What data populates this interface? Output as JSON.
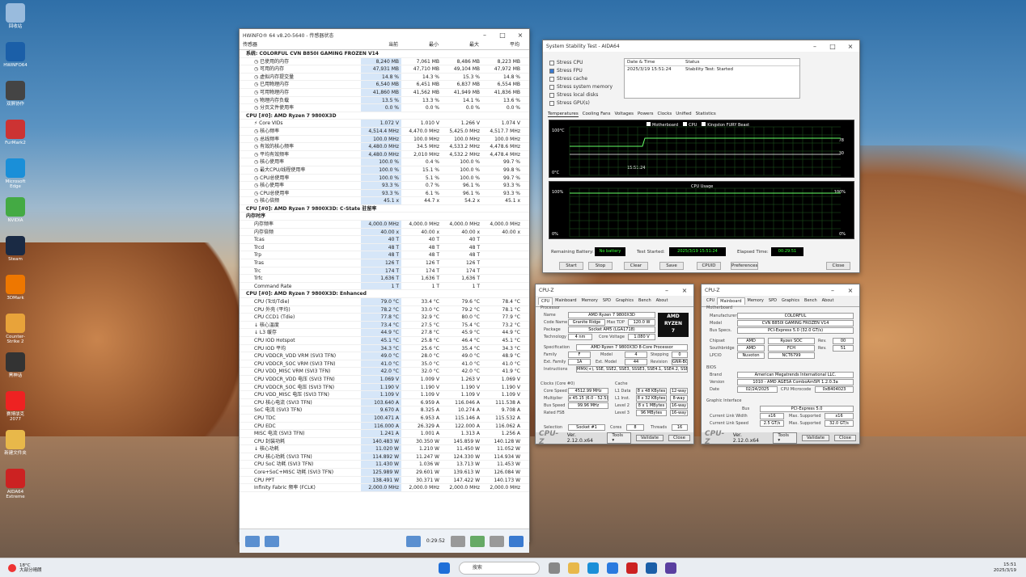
{
  "desktop": {
    "icons": [
      {
        "label": "回收站",
        "color": "#9bd"
      },
      {
        "label": "HWiNFO64",
        "color": "#1b5fa8"
      },
      {
        "label": "双屏协作",
        "color": "#444"
      },
      {
        "label": "FurMark2",
        "color": "#c33"
      },
      {
        "label": "Microsoft Edge",
        "color": "#1a8fd8"
      },
      {
        "label": "NVIDIA",
        "color": "#4a4"
      },
      {
        "label": "Steam",
        "color": "#1a2a44"
      },
      {
        "label": "3DMark",
        "color": "#e70"
      },
      {
        "label": "Counter-Strike 2",
        "color": "#e8a33a"
      },
      {
        "label": "黑神话",
        "color": "#333"
      },
      {
        "label": "赛博朋克 2077",
        "color": "#e22"
      },
      {
        "label": "新建文件夹",
        "color": "#e8b84a"
      },
      {
        "label": "AIDA64 Extreme",
        "color": "#c22"
      }
    ]
  },
  "hwinfo": {
    "title": "HWiNFO® 64 v8.20-5640 - 传感器状态",
    "cols": [
      "传感器",
      "当前",
      "最小",
      "最大",
      "平均"
    ],
    "rows": [
      {
        "g": 1,
        "n": "系统: COLORFUL CVN B850I GAMING FROZEN V14"
      },
      {
        "n": "◷ 已使用的内存",
        "v": [
          "8,240 MB",
          "7,061 MB",
          "8,486 MB",
          "8,223 MB"
        ]
      },
      {
        "n": "◷ 可用的内存",
        "v": [
          "47,931 MB",
          "47,710 MB",
          "49,104 MB",
          "47,972 MB"
        ]
      },
      {
        "n": "◷ 虚拟内存提交量",
        "v": [
          "14.8 %",
          "14.3 %",
          "15.3 %",
          "14.8 %"
        ]
      },
      {
        "n": "◷ 已用物理内存",
        "v": [
          "6,540 MB",
          "6,451 MB",
          "6,837 MB",
          "6,554 MB"
        ]
      },
      {
        "n": "◷ 可用物理内存",
        "v": [
          "41,860 MB",
          "41,562 MB",
          "41,949 MB",
          "41,836 MB"
        ]
      },
      {
        "n": "◷ 物理内存负载",
        "v": [
          "13.5 %",
          "13.3 %",
          "14.1 %",
          "13.6 %"
        ]
      },
      {
        "n": "◷ 分页文件使用率",
        "v": [
          "0.0 %",
          "0.0 %",
          "0.0 %",
          "0.0 %"
        ]
      },
      {
        "g": 1,
        "n": "CPU [#0]: AMD Ryzen 7 9800X3D"
      },
      {
        "n": "⚡ Core VIDs",
        "v": [
          "1.072 V",
          "1.010 V",
          "1.266 V",
          "1.074 V"
        ]
      },
      {
        "n": "◷ 核心频率",
        "v": [
          "4,514.4 MHz",
          "4,470.0 MHz",
          "5,425.0 MHz",
          "4,517.7 MHz"
        ]
      },
      {
        "n": "◷ 总线频率",
        "v": [
          "100.0 MHz",
          "100.0 MHz",
          "100.0 MHz",
          "100.0 MHz"
        ]
      },
      {
        "n": "◷ 有效的核心频率",
        "v": [
          "4,480.0 MHz",
          "34.5 MHz",
          "4,533.2 MHz",
          "4,478.6 MHz"
        ]
      },
      {
        "n": "◷ 平均有效频率",
        "v": [
          "4,480.0 MHz",
          "2,010 MHz",
          "4,532.2 MHz",
          "4,478.4 MHz"
        ]
      },
      {
        "n": "◷ 核心使用率",
        "v": [
          "100.0 %",
          "0.4 %",
          "100.0 %",
          "99.7 %"
        ]
      },
      {
        "n": "◷ 最大CPU/线程使用率",
        "v": [
          "100.0 %",
          "15.1 %",
          "100.0 %",
          "99.8 %"
        ]
      },
      {
        "n": "◷ CPU总使用率",
        "v": [
          "100.0 %",
          "5.1 %",
          "100.0 %",
          "99.7 %"
        ]
      },
      {
        "n": "◷ 核心使用率",
        "v": [
          "93.3 %",
          "0.7 %",
          "96.1 %",
          "93.3 %"
        ]
      },
      {
        "n": "◷ CPU总使用率",
        "v": [
          "93.3 %",
          "6.1 %",
          "96.1 %",
          "93.3 %"
        ]
      },
      {
        "n": "◷ 核心倍频",
        "v": [
          "45.1 x",
          "44.7 x",
          "54.2 x",
          "45.1 x"
        ]
      },
      {
        "g": 1,
        "n": "CPU [#0]: AMD Ryzen 7 9800X3D: C-State 驻留率"
      },
      {
        "g": 1,
        "n": "内存时序"
      },
      {
        "n": "内存频率",
        "v": [
          "4,000.0 MHz",
          "4,000.0 MHz",
          "4,000.0 MHz",
          "4,000.0 MHz"
        ]
      },
      {
        "n": "内存倍频",
        "v": [
          "40.00 x",
          "40.00 x",
          "40.00 x",
          "40.00 x"
        ]
      },
      {
        "n": "Tcas",
        "v": [
          "40 T",
          "40 T",
          "40 T",
          ""
        ]
      },
      {
        "n": "Trcd",
        "v": [
          "48 T",
          "48 T",
          "48 T",
          ""
        ]
      },
      {
        "n": "Trp",
        "v": [
          "48 T",
          "48 T",
          "48 T",
          ""
        ]
      },
      {
        "n": "Tras",
        "v": [
          "126 T",
          "126 T",
          "126 T",
          ""
        ]
      },
      {
        "n": "Trc",
        "v": [
          "174 T",
          "174 T",
          "174 T",
          ""
        ]
      },
      {
        "n": "Trfc",
        "v": [
          "1,636 T",
          "1,636 T",
          "1,636 T",
          ""
        ]
      },
      {
        "n": "Command Rate",
        "v": [
          "1 T",
          "1 T",
          "1 T",
          ""
        ]
      },
      {
        "g": 1,
        "n": "CPU [#0]: AMD Ryzen 7 9800X3D: Enhanced"
      },
      {
        "n": "CPU (Tctl/Tdie)",
        "v": [
          "79.0 °C",
          "33.4 °C",
          "79.6 °C",
          "78.4 °C"
        ]
      },
      {
        "n": "CPU 外壳 (平均)",
        "v": [
          "78.2 °C",
          "33.0 °C",
          "79.2 °C",
          "78.1 °C"
        ]
      },
      {
        "n": "CPU CCD1 (Tdie)",
        "v": [
          "77.8 °C",
          "32.9 °C",
          "80.0 °C",
          "77.9 °C"
        ]
      },
      {
        "n": "↓ 核心温度",
        "v": [
          "73.4 °C",
          "27.5 °C",
          "75.4 °C",
          "73.2 °C"
        ]
      },
      {
        "n": "↓ L3 缓存",
        "v": [
          "44.9 °C",
          "27.8 °C",
          "45.9 °C",
          "44.9 °C"
        ]
      },
      {
        "n": "CPU IOD Hotspot",
        "v": [
          "45.1 °C",
          "25.8 °C",
          "46.4 °C",
          "45.1 °C"
        ]
      },
      {
        "n": "CPU IOD 平均",
        "v": [
          "34.3 °C",
          "25.6 °C",
          "35.4 °C",
          "34.3 °C"
        ]
      },
      {
        "n": "CPU VDDCR_VDD VRM (SVI3 TFN)",
        "v": [
          "49.0 °C",
          "28.0 °C",
          "49.0 °C",
          "48.9 °C"
        ]
      },
      {
        "n": "CPU VDDCR_SOC VRM (SVI3 TFN)",
        "v": [
          "41.0 °C",
          "35.0 °C",
          "41.0 °C",
          "41.0 °C"
        ]
      },
      {
        "n": "CPU VDD_MISC VRM (SVI3 TFN)",
        "v": [
          "42.0 °C",
          "32.0 °C",
          "42.0 °C",
          "41.9 °C"
        ]
      },
      {
        "n": "CPU VDDCR_VDD 电压 (SVI3 TFN)",
        "v": [
          "1.069 V",
          "1.009 V",
          "1.263 V",
          "1.069 V"
        ]
      },
      {
        "n": "CPU VDDCR_SOC 电压 (SVI3 TFN)",
        "v": [
          "1.190 V",
          "1.190 V",
          "1.190 V",
          "1.190 V"
        ]
      },
      {
        "n": "CPU VDD_MISC 电压 (SVI3 TFN)",
        "v": [
          "1.109 V",
          "1.109 V",
          "1.109 V",
          "1.109 V"
        ]
      },
      {
        "n": "CPU 核心电流 (SVI3 TFN)",
        "v": [
          "103.640 A",
          "6.959 A",
          "116.046 A",
          "111.538 A"
        ]
      },
      {
        "n": "SoC 电流 (SVI3 TFN)",
        "v": [
          "9.670 A",
          "8.325 A",
          "10.274 A",
          "9.708 A"
        ]
      },
      {
        "n": "CPU TDC",
        "v": [
          "100.471 A",
          "6.953 A",
          "115.146 A",
          "115.532 A"
        ]
      },
      {
        "n": "CPU EDC",
        "v": [
          "116.000 A",
          "26.329 A",
          "122.000 A",
          "116.062 A"
        ]
      },
      {
        "n": "MISC 电流 (SVI3 TFN)",
        "v": [
          "1.241 A",
          "1.001 A",
          "1.313 A",
          "1.256 A"
        ]
      },
      {
        "n": "CPU 封装功耗",
        "v": [
          "140.483 W",
          "30.350 W",
          "145.859 W",
          "140.128 W"
        ]
      },
      {
        "n": "↓ 核心功耗",
        "v": [
          "11.020 W",
          "1.210 W",
          "11.450 W",
          "11.052 W"
        ]
      },
      {
        "n": "CPU 核心功耗 (SVI3 TFN)",
        "v": [
          "114.892 W",
          "11.247 W",
          "124.330 W",
          "114.934 W"
        ]
      },
      {
        "n": "CPU SoC 功耗 (SVI3 TFN)",
        "v": [
          "11.430 W",
          "1.036 W",
          "13.713 W",
          "11.453 W"
        ]
      },
      {
        "n": "Core+SoC+MISC 功耗 (SVI3 TFN)",
        "v": [
          "125.989 W",
          "29.601 W",
          "139.613 W",
          "126.084 W"
        ]
      },
      {
        "n": "CPU PPT",
        "v": [
          "138.491 W",
          "30.371 W",
          "147.422 W",
          "140.173 W"
        ]
      },
      {
        "n": "Infinity Fabric 频率 (FCLK)",
        "v": [
          "2,000.0 MHz",
          "2,000.0 MHz",
          "2,000.0 MHz",
          "2,000.0 MHz"
        ]
      }
    ],
    "timer": "0:29:52"
  },
  "aida": {
    "title": "System Stability Test - AIDA64",
    "checks": [
      {
        "label": "Stress CPU",
        "checked": false
      },
      {
        "label": "Stress FPU",
        "checked": true
      },
      {
        "label": "Stress cache",
        "checked": false
      },
      {
        "label": "Stress system memory",
        "checked": false
      },
      {
        "label": "Stress local disks",
        "checked": false
      },
      {
        "label": "Stress GPU(s)",
        "checked": false
      }
    ],
    "log_headers": [
      "Date & Time",
      "Status"
    ],
    "log": {
      "time": "2025/3/19 15:51:24",
      "status": "Stability Test: Started"
    },
    "tabs": [
      "Temperatures",
      "Cooling Fans",
      "Voltages",
      "Powers",
      "Clocks",
      "Unified",
      "Statistics"
    ],
    "legend": [
      "Motherboard",
      "CPU",
      "Kingston FURY Beast"
    ],
    "graph1": {
      "top": "100°C",
      "bottom": "0°C",
      "right_top": "78",
      "right_bottom": "30",
      "time": "15:51:24"
    },
    "graph2": {
      "title": "CPU Usage",
      "top": "100%",
      "bottom": "0%",
      "right_top": "100%",
      "right_bottom": "0%"
    },
    "battery_label": "Remaining Battery:",
    "battery": "No battery",
    "started_label": "Test Started:",
    "started": "2025/3/19 15:51:24",
    "elapsed_label": "Elapsed Time:",
    "elapsed": "00:29:51",
    "buttons": [
      "Start",
      "Stop",
      "Clear",
      "Save",
      "CPUID",
      "Preferences",
      "Close"
    ]
  },
  "cpuz1": {
    "title": "CPU-Z",
    "tabs": [
      "CPU",
      "Mainboard",
      "Memory",
      "SPD",
      "Graphics",
      "Bench",
      "About"
    ],
    "name": "AMD Ryzen 7 9800X3D",
    "codename": "Granite Ridge",
    "maxtdp": "120.0 W",
    "package": "Socket AM5 (LGA1718)",
    "technology": "4 nm",
    "corevoltage": "1.080 V",
    "spec": "AMD Ryzen 7 9800X3D 8-Core Processor",
    "family": "F",
    "model": "4",
    "stepping": "0",
    "extfamily": "1A",
    "extmodel": "44",
    "revision": "GNR-B0",
    "instr": "MMX(+), SSE, SSE2, SSE3, SSSE3, SSE4.1, SSE4.2, SSE4A, x86-64, AES, AVX, AVX2, AVX-VNNI, AVX512, FMA3, SHA",
    "corespeed": "4512.99 MHz",
    "multiplier": "x 45.15 (6.0 - 52.5)",
    "busspeed": "99.96 MHz",
    "l1d": "8 x 48 KBytes",
    "l1d_w": "12-way",
    "l1i": "8 x 32 KBytes",
    "l1i_w": "8-way",
    "l2": "8 x 1 MBytes",
    "l2_w": "16-way",
    "l3": "96 MBytes",
    "l3_w": "16-way",
    "selection": "Socket #1",
    "cores": "8",
    "threads": "16",
    "version": "Ver. 2.12.0.x64"
  },
  "cpuz2": {
    "title": "CPU-Z",
    "tabs": [
      "CPU",
      "Mainboard",
      "Memory",
      "SPD",
      "Graphics",
      "Bench",
      "About"
    ],
    "manufacturer": "COLORFUL",
    "model": "CVN B850I GAMING FROZEN V14",
    "busspec": "PCI-Express 5.0 (32.0 GT/s)",
    "chipset": "AMD",
    "chipset2": "Ryzen SOC",
    "chip_rev": "00",
    "southbridge": "AMD",
    "south2": "FCH",
    "south_rev": "51",
    "lpcio": "Nuvoton",
    "lpcio2": "NCT6799",
    "bios_brand": "American Megatrends International LLC.",
    "bios_version": "1010 - AMD AGESA ComboAm5PI 1.2.0.3a",
    "bios_date": "02/24/2025",
    "microcode": "0xB404023",
    "gi_bus": "PCI-Express 5.0",
    "link_width": "x16",
    "max_width": "x16",
    "link_speed": "2.5 GT/s",
    "max_speed": "32.0 GT/s",
    "version": "Ver. 2.12.0.x64"
  },
  "taskbar": {
    "weather_temp": "18°C",
    "weather_desc": "大部分晴朗",
    "search": "搜索",
    "time": "15:51",
    "date": "2025/3/19"
  }
}
